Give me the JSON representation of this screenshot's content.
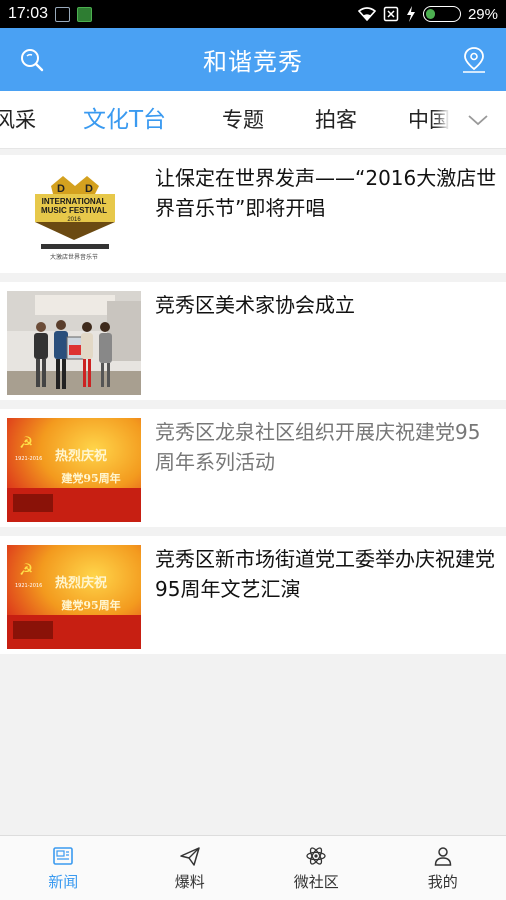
{
  "status_bar": {
    "time": "17:03",
    "battery_text": "29%",
    "battery_level": 0.29
  },
  "header": {
    "title": "和谐竞秀"
  },
  "tabs": [
    {
      "label": "风采"
    },
    {
      "label": "文化T台"
    },
    {
      "label": "专题"
    },
    {
      "label": "拍客"
    },
    {
      "label": "中国"
    }
  ],
  "articles": [
    {
      "title": "让保定在世界发声——“2016大激店世界音乐节”即将开唱",
      "logo_text": [
        "INTERNATIONAL",
        "MUSIC FESTIVAL",
        "2016",
        "大激店世界音乐节"
      ]
    },
    {
      "title": "竞秀区美术家协会成立"
    },
    {
      "title": "竞秀区龙泉社区组织开展庆祝建党95周年系列活动",
      "banner_text": [
        "热烈庆祝",
        "建党95周年"
      ],
      "banner_year": "1921-2016"
    },
    {
      "title": "竞秀区新市场街道党工委举办庆祝建党95周年文艺汇演",
      "banner_text": [
        "热烈庆祝",
        "建党95周年"
      ],
      "banner_year": "1921-2016"
    }
  ],
  "bottom_nav": [
    {
      "label": "新闻"
    },
    {
      "label": "爆料"
    },
    {
      "label": "微社区"
    },
    {
      "label": "我的"
    }
  ],
  "colors": {
    "accent": "#4aa1f3",
    "active_tab": "#3a9af0",
    "read_title": "#777777"
  }
}
